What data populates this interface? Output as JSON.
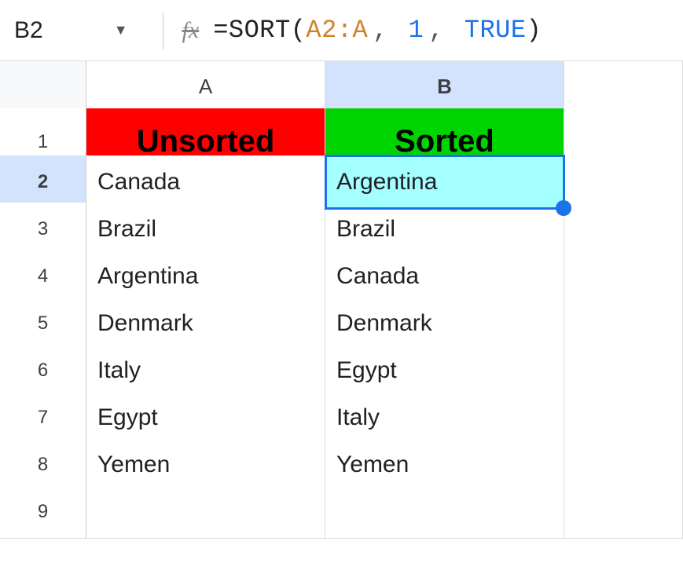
{
  "nameBox": {
    "cellRef": "B2"
  },
  "formula": {
    "eq": "=",
    "fn": "SORT",
    "lparen": "(",
    "range": "A2:A",
    "comma": ",",
    "num": "1",
    "bool": "TRUE",
    "rparen": ")"
  },
  "columns": {
    "A": "A",
    "B": "B"
  },
  "rowNums": {
    "r1": "1",
    "r2": "2",
    "r3": "3",
    "r4": "4",
    "r5": "5",
    "r6": "6",
    "r7": "7",
    "r8": "8",
    "r9": "9"
  },
  "headers": {
    "A": "Unsorted",
    "B": "Sorted"
  },
  "dataA": {
    "r2": "Canada",
    "r3": "Brazil",
    "r4": "Argentina",
    "r5": "Denmark",
    "r6": "Italy",
    "r7": "Egypt",
    "r8": "Yemen"
  },
  "dataB": {
    "r2": "Argentina",
    "r3": "Brazil",
    "r4": "Canada",
    "r5": "Denmark",
    "r6": "Egypt",
    "r7": "Italy",
    "r8": "Yemen"
  },
  "activeCell": "B2"
}
